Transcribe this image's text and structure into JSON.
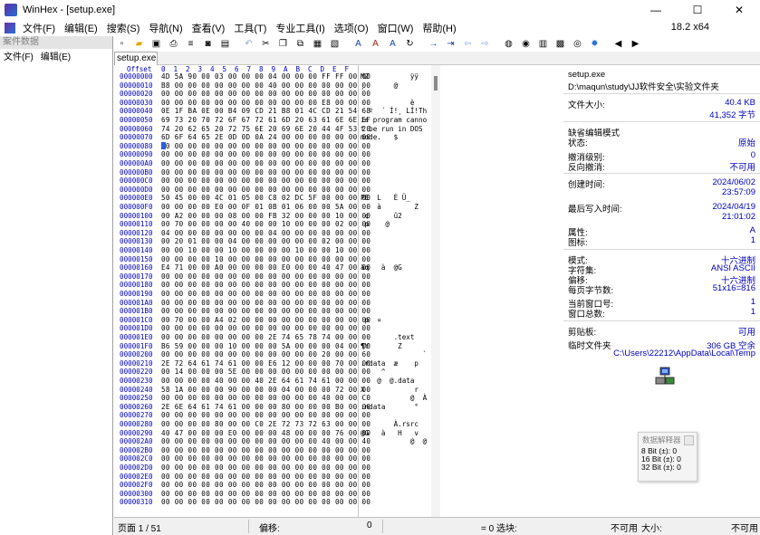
{
  "window": {
    "title": "WinHex - [setup.exe]",
    "minimize": "—",
    "maximize": "☐",
    "close": "✕"
  },
  "menu": {
    "items": [
      "文件(F)",
      "编辑(E)",
      "搜索(S)",
      "导航(N)",
      "查看(V)",
      "工具(T)",
      "专业工具(I)",
      "选项(O)",
      "窗口(W)",
      "帮助(H)"
    ],
    "version": "18.2 x64"
  },
  "left_panel": {
    "header": "案件数据",
    "menu": [
      "文件(F)",
      "编辑(E)"
    ]
  },
  "toolbar": {
    "icons": [
      "new-file-icon",
      "open-folder-icon",
      "save-icon",
      "print-icon",
      "properties-icon",
      "open-disk-icon",
      "open-ram-icon",
      "sep",
      "undo-icon",
      "cut-icon",
      "copy-icon",
      "copy-block-icon",
      "paste-icon",
      "paste-block-icon",
      "sep",
      "find-text-icon",
      "find-hex-icon",
      "replace-text-icon",
      "replace-hex-icon",
      "sep",
      "goto-offset-icon",
      "goto-end-icon",
      "back-icon",
      "forward-icon",
      "sep",
      "disk-editor-icon",
      "ram-editor-icon",
      "calculator-icon",
      "hash-icon",
      "search-icon",
      "options-icon",
      "sep",
      "prev-icon",
      "next-icon"
    ]
  },
  "tab": {
    "label": "setup.exe"
  },
  "hex": {
    "header_offset": "Offset",
    "header_cols": [
      "0",
      "1",
      "2",
      "3",
      "4",
      "5",
      "6",
      "7",
      "8",
      "9",
      "A",
      "B",
      "C",
      "D",
      "E",
      "F"
    ],
    "rows": [
      {
        "off": "00000000",
        "hex": "4D 5A 90 00 03 00 00 00 04 00 00 00 FF FF 00 00",
        "asc": "MZ          ÿÿ"
      },
      {
        "off": "00000010",
        "hex": "B8 00 00 00 00 00 00 00 40 00 00 00 00 00 00 00",
        "asc": "¸       @"
      },
      {
        "off": "00000020",
        "hex": "00 00 00 00 00 00 00 00 00 00 00 00 00 00 00 00",
        "asc": ""
      },
      {
        "off": "00000030",
        "hex": "00 00 00 00 00 00 00 00 00 00 00 00 E8 00 00 00",
        "asc": "            è"
      },
      {
        "off": "00000040",
        "hex": "0E 1F BA 0E 00 B4 09 CD 21 B8 01 4C CD 21 54 68",
        "asc": "  º  ´ Í!¸ LÍ!Th"
      },
      {
        "off": "00000050",
        "hex": "69 73 20 70 72 6F 67 72 61 6D 20 63 61 6E 6E 6F",
        "asc": "is program canno"
      },
      {
        "off": "00000060",
        "hex": "74 20 62 65 20 72 75 6E 20 69 6E 20 44 4F 53 20",
        "asc": "t be run in DOS "
      },
      {
        "off": "00000070",
        "hex": "6D 6F 64 65 2E 0D 0D 0A 24 00 00 00 00 00 00 00",
        "asc": "mode.   $"
      },
      {
        "off": "00000080",
        "hex": "00 00 00 00 00 00 00 00 00 00 00 00 00 00 00 00",
        "asc": ""
      },
      {
        "off": "00000090",
        "hex": "00 00 00 00 00 00 00 00 00 00 00 00 00 00 00 00",
        "asc": ""
      },
      {
        "off": "000000A0",
        "hex": "00 00 00 00 00 00 00 00 00 00 00 00 00 00 00 00",
        "asc": ""
      },
      {
        "off": "000000B0",
        "hex": "00 00 00 00 00 00 00 00 00 00 00 00 00 00 00 00",
        "asc": ""
      },
      {
        "off": "000000C0",
        "hex": "00 00 00 00 00 00 00 00 00 00 00 00 00 00 00 00",
        "asc": ""
      },
      {
        "off": "000000D0",
        "hex": "00 00 00 00 00 00 00 00 00 00 00 00 00 00 00 00",
        "asc": ""
      },
      {
        "off": "000000E0",
        "hex": "50 45 00 00 4C 01 05 00 C8 02 DC 5F 00 00 00 00",
        "asc": "PE  L   È Ü_"
      },
      {
        "off": "000000F0",
        "hex": "00 00 00 00 E0 00 0F 01 0B 01 06 00 00 5A 00 00",
        "asc": "    à        Z"
      },
      {
        "off": "00000100",
        "hex": "00 A2 00 00 00 08 00 00 FB 32 00 00 00 10 00 00",
        "asc": " ¢      û2"
      },
      {
        "off": "00000110",
        "hex": "00 70 00 00 00 00 40 00 00 10 00 00 00 02 00 00",
        "asc": " p    @"
      },
      {
        "off": "00000120",
        "hex": "04 00 00 00 00 00 00 00 04 00 00 00 00 00 00 00",
        "asc": ""
      },
      {
        "off": "00000130",
        "hex": "00 20 01 00 00 04 00 00 00 00 00 00 02 00 00 00",
        "asc": ""
      },
      {
        "off": "00000140",
        "hex": "00 00 10 00 00 10 00 00 00 00 10 00 00 10 00 00",
        "asc": ""
      },
      {
        "off": "00000150",
        "hex": "00 00 00 00 10 00 00 00 00 00 00 00 00 00 00 00",
        "asc": ""
      },
      {
        "off": "00000160",
        "hex": "E4 71 00 00 A0 00 00 00 00 E0 00 00 40 47 00 00",
        "asc": "äq   à  @G"
      },
      {
        "off": "00000170",
        "hex": "00 00 00 00 00 00 00 00 00 00 00 00 00 00 00 00",
        "asc": ""
      },
      {
        "off": "00000180",
        "hex": "00 00 00 00 00 00 00 00 00 00 00 00 00 00 00 00",
        "asc": ""
      },
      {
        "off": "00000190",
        "hex": "00 00 00 00 00 00 00 00 00 00 00 00 00 00 00 00",
        "asc": ""
      },
      {
        "off": "000001A0",
        "hex": "00 00 00 00 00 00 00 00 00 00 00 00 00 00 00 00",
        "asc": ""
      },
      {
        "off": "000001B0",
        "hex": "00 00 00 00 00 00 00 00 00 00 00 00 00 00 00 00",
        "asc": ""
      },
      {
        "off": "000001C0",
        "hex": "00 70 00 00 A4 02 00 00 00 00 00 00 00 00 00 00",
        "asc": " p  ¤"
      },
      {
        "off": "000001D0",
        "hex": "00 00 00 00 00 00 00 00 00 00 00 00 00 00 00 00",
        "asc": ""
      },
      {
        "off": "000001E0",
        "hex": "00 00 00 00 00 00 00 00 2E 74 65 78 74 00 00 00",
        "asc": "        .text"
      },
      {
        "off": "000001F0",
        "hex": "B6 59 00 00 00 10 00 00 00 5A 00 00 00 04 00 00",
        "asc": "¶Y       Z"
      },
      {
        "off": "00000200",
        "hex": "00 00 00 00 00 00 00 00 00 00 00 00 20 00 00 60",
        "asc": "               `"
      },
      {
        "off": "00000210",
        "hex": "2E 72 64 61 74 61 00 00 E6 12 00 00 00 70 00 00",
        "asc": ".rdata  æ    p"
      },
      {
        "off": "00000220",
        "hex": "00 14 00 00 00 5E 00 00 00 00 00 00 00 00 00 00",
        "asc": "     ^"
      },
      {
        "off": "00000230",
        "hex": "00 00 00 00 40 00 00 40 2E 64 61 74 61 00 00 00",
        "asc": "    @  @.data"
      },
      {
        "off": "00000240",
        "hex": "58 1A 00 00 00 90 00 00 00 04 00 00 00 72 00 00",
        "asc": "X            r"
      },
      {
        "off": "00000250",
        "hex": "00 00 00 00 00 00 00 00 00 00 00 00 40 00 00 C0",
        "asc": "            @  À"
      },
      {
        "off": "00000260",
        "hex": "2E 6E 64 61 74 61 00 00 00 80 00 00 00 B0 00 00",
        "asc": ".ndata       °"
      },
      {
        "off": "00000270",
        "hex": "00 00 00 00 00 00 00 00 00 00 00 00 00 00 00 00",
        "asc": ""
      },
      {
        "off": "00000280",
        "hex": "00 00 00 00 80 00 00 C0 2E 72 73 72 63 00 00 00",
        "asc": "        À.rsrc"
      },
      {
        "off": "00000290",
        "hex": "40 47 00 00 00 E0 00 00 00 48 00 00 00 76 00 00",
        "asc": "@G   à   H   v"
      },
      {
        "off": "000002A0",
        "hex": "00 00 00 00 00 00 00 00 00 00 00 00 40 00 00 40",
        "asc": "            @  @"
      },
      {
        "off": "000002B0",
        "hex": "00 00 00 00 00 00 00 00 00 00 00 00 00 00 00 00",
        "asc": ""
      },
      {
        "off": "000002C0",
        "hex": "00 00 00 00 00 00 00 00 00 00 00 00 00 00 00 00",
        "asc": ""
      },
      {
        "off": "000002D0",
        "hex": "00 00 00 00 00 00 00 00 00 00 00 00 00 00 00 00",
        "asc": ""
      },
      {
        "off": "000002E0",
        "hex": "00 00 00 00 00 00 00 00 00 00 00 00 00 00 00 00",
        "asc": ""
      },
      {
        "off": "000002F0",
        "hex": "00 00 00 00 00 00 00 00 00 00 00 00 00 00 00 00",
        "asc": ""
      },
      {
        "off": "00000300",
        "hex": "00 00 00 00 00 00 00 00 00 00 00 00 00 00 00 00",
        "asc": ""
      },
      {
        "off": "00000310",
        "hex": "00 00 00 00 00 00 00 00 00 00 00 00 00 00 00 00",
        "asc": ""
      }
    ]
  },
  "info": {
    "filename": "setup.exe",
    "path": "D:\\maqun\\study\\JJ软件安全\\实验文件夹",
    "size_label": "文件大小:",
    "size_kb": "40.4 KB",
    "size_bytes": "41,352 字节",
    "edit_mode_label": "缺省编辑模式",
    "state_label": "状态:",
    "state_val": "原始",
    "undo_level_label": "撤消级别:",
    "undo_level_val": "0",
    "undo_reverse_label": "反向撤消:",
    "undo_reverse_val": "不可用",
    "created_label": "创建时间:",
    "created_date": "2024/06/02",
    "created_time": "23:57:09",
    "modified_label": "最后写入时间:",
    "modified_date": "2024/04/19",
    "modified_time": "21:01:02",
    "attr_label": "属性:",
    "attr_val": "A",
    "icons_label": "图标:",
    "icons_val": "1",
    "mode_label": "模式:",
    "mode_val": "十六进制",
    "charset_label": "字符集:",
    "charset_val": "ANSI ASCII",
    "offset_label": "偏移:",
    "offset_val": "十六进制",
    "bpp_label": "每页字节数:",
    "bpp_val": "51x16=816",
    "window_no_label": "当前窗口号:",
    "window_no_val": "1",
    "windows_total_label": "窗口总数:",
    "windows_total_val": "1",
    "clipboard_label": "剪贴板:",
    "clipboard_val": "可用",
    "temp_label": "临时文件夹",
    "temp_free": "306 GB 空余",
    "temp_path": "C:\\Users\\22212\\AppData\\Local\\Temp"
  },
  "data_popup": {
    "title": "数据解释器",
    "lines": [
      "8 Bit (±): 0",
      "16 Bit (±): 0",
      "32 Bit (±): 0"
    ]
  },
  "status": {
    "page": "页面 1 / 51",
    "offset_label": "偏移:",
    "offset_val": "0",
    "value": "= 0 选块:",
    "na": "不可用",
    "size_label": "大小:",
    "size_val": "不可用"
  }
}
